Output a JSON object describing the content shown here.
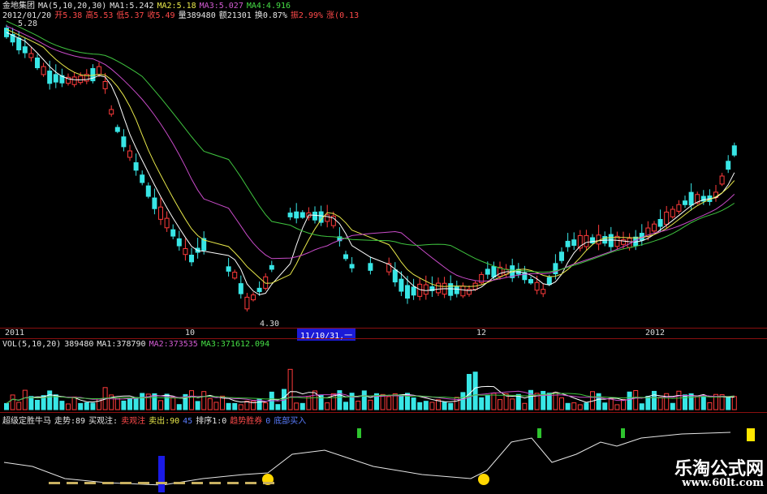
{
  "header": {
    "stock_name": "金地集团",
    "ma_label": "MA(5,10,20,30)",
    "ma1": "MA1:5.242",
    "ma2": "MA2:5.18",
    "ma3": "MA3:5.027",
    "ma4": "MA4:4.916",
    "date": "2012/01/20",
    "open": "开5.38",
    "high": "高5.53",
    "low": "低5.37",
    "close": "收5.49",
    "volume": "量389480",
    "amount": "额21301",
    "turnover": "换0.87%",
    "amplitude": "振2.99%",
    "change": "涨(0.13"
  },
  "price_chart": {
    "high_label": "5.28",
    "low_label": "4.30"
  },
  "time_axis": {
    "labels": [
      "2011",
      "10",
      "11/10/31,一",
      "12",
      "2012"
    ]
  },
  "vol_panel": {
    "label": "VOL(5,10,20)",
    "value": "389480",
    "ma1": "MA1:378790",
    "ma2": "MA2:373535",
    "ma3": "MA3:371612.094"
  },
  "indicator_panel": {
    "name": "超级定胜牛马",
    "trend": "走势:89",
    "buy_attention": "买观注:",
    "sell_attention": "卖观注",
    "sell_out": "卖出:90",
    "value_45": "45",
    "sort": "排序1:0",
    "strong_trend": "趋势胜券",
    "zero": "0",
    "buy_mark": "底部买入"
  },
  "watermark": {
    "site_name": "乐淘公式网",
    "url": "www.60lt.com"
  },
  "colors": {
    "up": "#ff3b3b",
    "down": "#38e6e6",
    "ma5": "#ffffff",
    "ma10": "#e8e84a",
    "ma20": "#c84bc8",
    "ma30": "#3fc43f",
    "separator": "#8a1010"
  }
}
